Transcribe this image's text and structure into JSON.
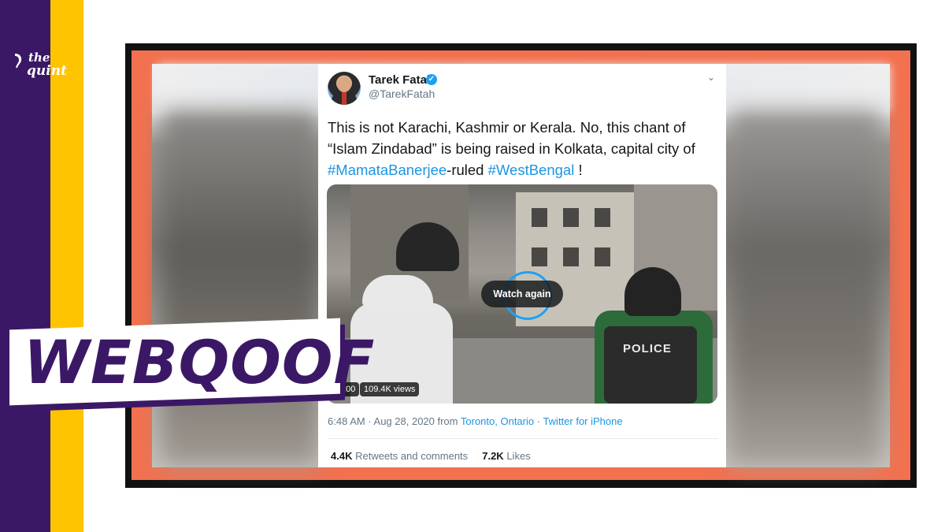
{
  "brand": {
    "logo_line1": "the",
    "logo_line2": "quint",
    "stamp": "WEBQOOF"
  },
  "tweet": {
    "author_name": "Tarek Fatah",
    "handle": "@TarekFatah",
    "verified": true,
    "text_part1": "This is not Karachi, Kashmir or Kerala. No, this chant of “Islam Zindabad” is being raised in Kolkata, capital city of ",
    "hashtag1": "#MamataBanerjee",
    "text_part2": "-ruled ",
    "hashtag2": "#WestBengal",
    "text_part3": " !",
    "video": {
      "overlay_label": "Watch again",
      "time": "0:00",
      "views": "109.4K views",
      "vest_text": "POLICE"
    },
    "meta": {
      "timestamp": "6:48 AM · Aug 28, 2020 from",
      "location": "Toronto, Ontario",
      "separator": " · ",
      "client": "Twitter for iPhone"
    },
    "stats": {
      "retweets_count": "4.4K",
      "retweets_label": "Retweets and comments",
      "likes_count": "7.2K",
      "likes_label": "Likes"
    }
  },
  "colors": {
    "purple": "#3b1866",
    "yellow": "#ffc400",
    "orange_frame": "#f2714f",
    "twitter_blue": "#1b95e0"
  }
}
